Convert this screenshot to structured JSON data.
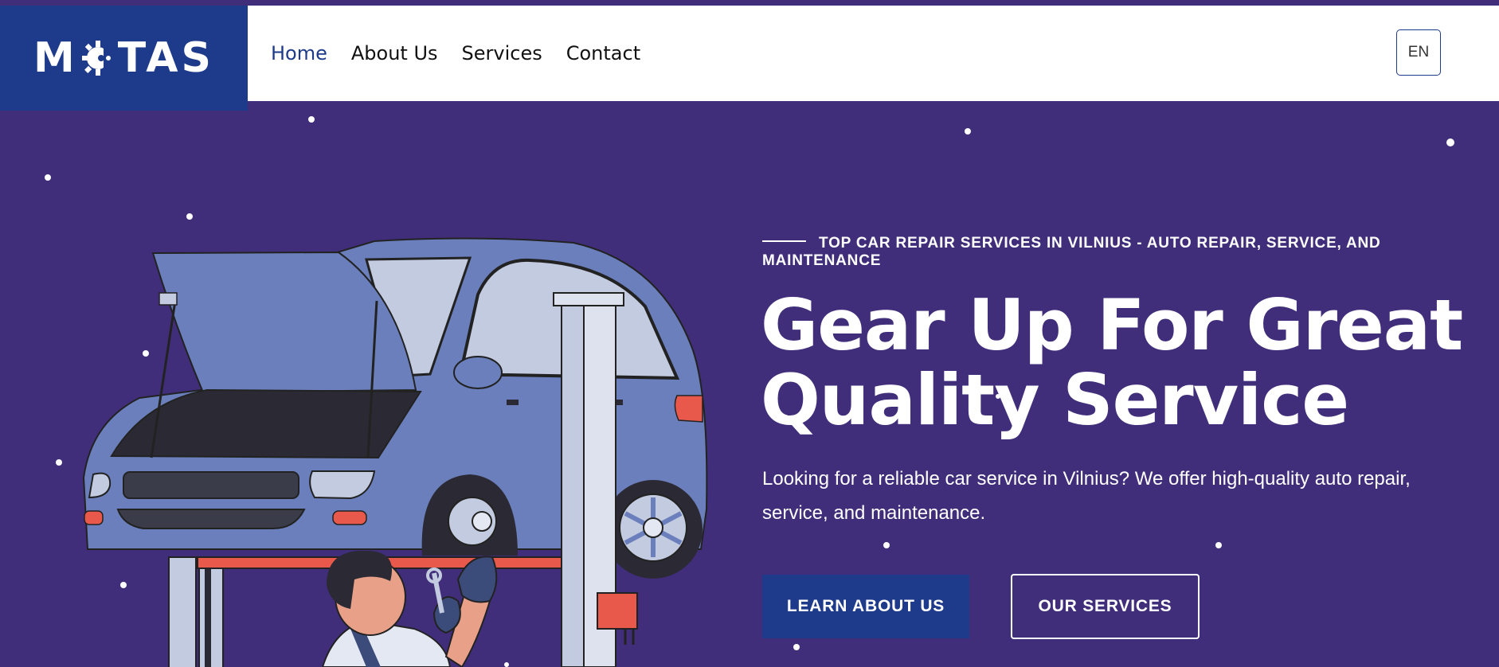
{
  "brand": {
    "logo_text_left": "M",
    "logo_text_right": "TAS",
    "logo_color": "#1e3a8a"
  },
  "nav": {
    "items": [
      {
        "label": "Home",
        "active": true
      },
      {
        "label": "About Us",
        "active": false
      },
      {
        "label": "Services",
        "active": false
      },
      {
        "label": "Contact",
        "active": false
      }
    ],
    "language": "EN"
  },
  "hero": {
    "eyebrow": "TOP CAR REPAIR SERVICES IN VILNIUS - AUTO REPAIR, SERVICE, AND MAINTENANCE",
    "title_line1": "Gear Up For Great",
    "title_line2": "Quality Service",
    "subtitle": "Looking for a reliable car service in Vilnius? We offer high-quality auto repair, service, and maintenance.",
    "primary_button": "LEARN ABOUT US",
    "secondary_button": "OUR SERVICES"
  },
  "colors": {
    "background": "#412e7b",
    "accent": "#1e3a8a",
    "car_body": "#6a7fbb",
    "lift_red": "#e8584b",
    "white": "#ffffff"
  },
  "icons": [
    "gear-logo-icon",
    "car-illustration",
    "mechanic-illustration",
    "car-lift-illustration"
  ]
}
